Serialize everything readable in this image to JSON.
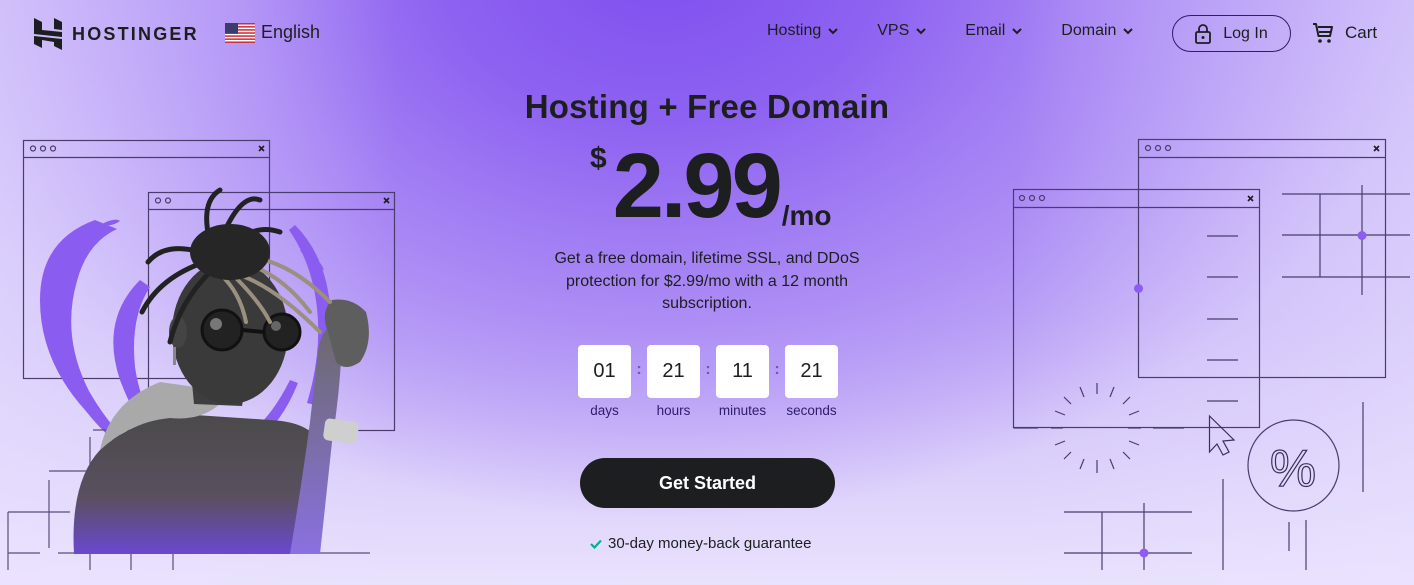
{
  "header": {
    "logo_text": "HOSTINGER",
    "language": {
      "label": "English",
      "flag": "us-flag-icon"
    },
    "nav": [
      {
        "label": "Hosting",
        "icon": "chevron-down-icon"
      },
      {
        "label": "VPS",
        "icon": "chevron-down-icon"
      },
      {
        "label": "Email",
        "icon": "chevron-down-icon"
      },
      {
        "label": "Domain",
        "icon": "chevron-down-icon"
      }
    ],
    "login": {
      "label": "Log In",
      "icon": "lock-icon"
    },
    "cart": {
      "label": "Cart",
      "icon": "cart-icon"
    }
  },
  "hero": {
    "title": "Hosting + Free Domain",
    "price": {
      "currency": "$",
      "amount": "2.99",
      "period": "/mo"
    },
    "description": "Get a free domain, lifetime SSL, and DDoS protection for $2.99/mo with a 12 month subscription.",
    "countdown": [
      {
        "value": "01",
        "label": "days"
      },
      {
        "value": "21",
        "label": "hours"
      },
      {
        "value": "11",
        "label": "minutes"
      },
      {
        "value": "21",
        "label": "seconds"
      }
    ],
    "countdown_separator": ":",
    "cta_label": "Get Started",
    "guarantee": {
      "label": "30-day money-back guarantee",
      "icon": "checkmark-icon"
    }
  },
  "decorations": {
    "window_controls": "○○○",
    "close_glyph": "×",
    "percent_glyph": "%"
  },
  "colors": {
    "brand_purple": "#7f4ff0",
    "accent_dot": "#8c5cf4",
    "text_dark": "#1d1e20",
    "cta_bg": "#1d1e20",
    "check_green": "#00b090"
  }
}
